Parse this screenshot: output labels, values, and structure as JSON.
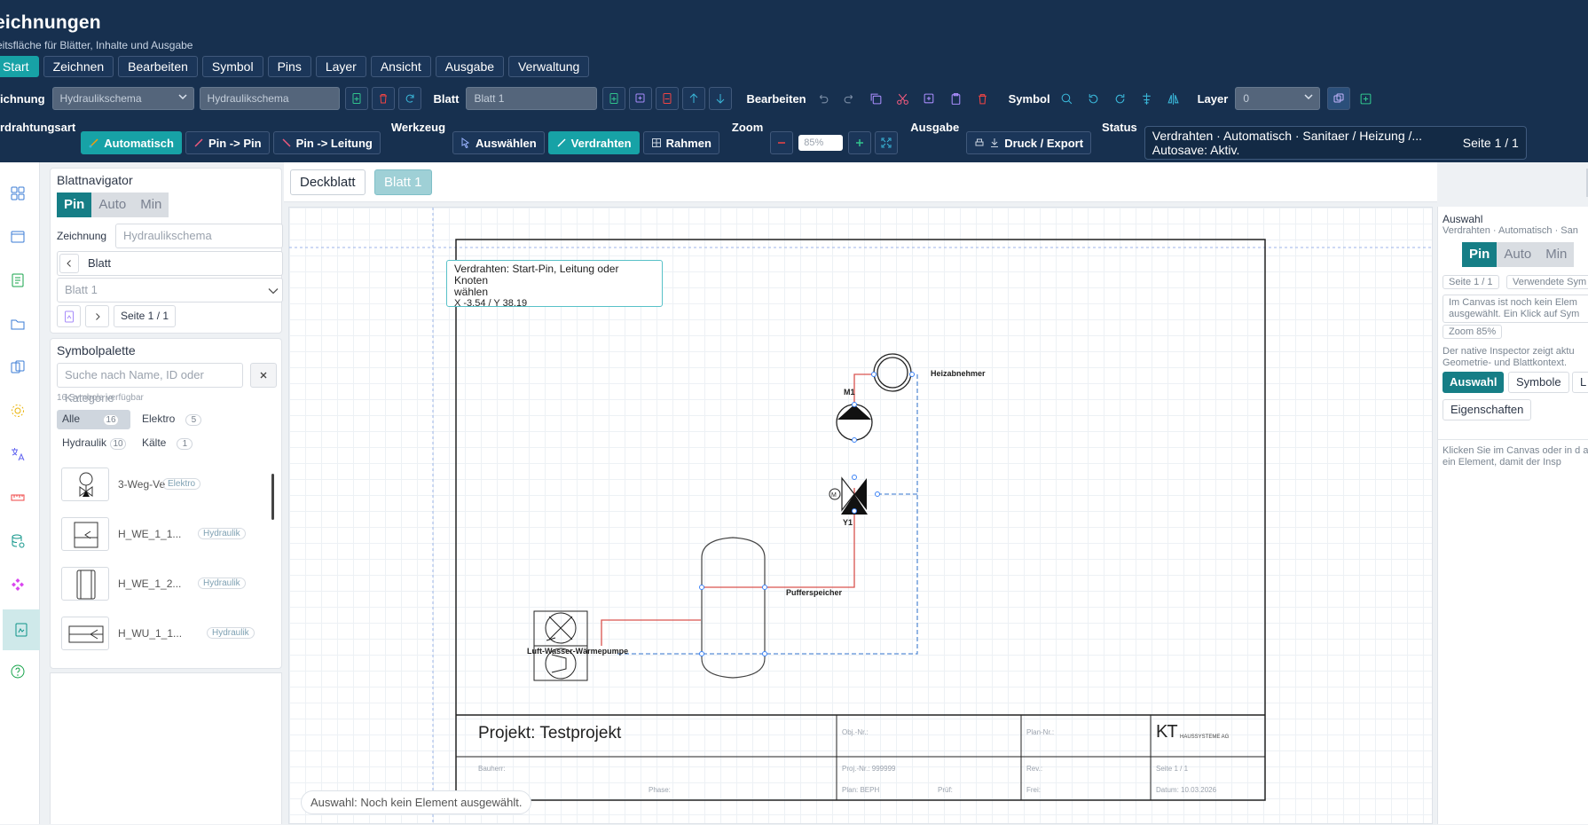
{
  "app": {
    "title": "eichnungen",
    "subtitle": "eitsfläche für Blätter, Inhalte und Ausgabe"
  },
  "menu": [
    "Start",
    "Zeichnen",
    "Bearbeiten",
    "Symbol",
    "Pins",
    "Layer",
    "Ansicht",
    "Ausgabe",
    "Verwaltung"
  ],
  "toolbar1": {
    "zeichnung_label": "ichnung",
    "zeichnung_select": "Hydraulikschema",
    "zeichnung_name": "Hydraulikschema",
    "blatt_label": "Blatt",
    "blatt_value": "Blatt 1",
    "bearbeiten_label": "Bearbeiten",
    "symbol_label": "Symbol",
    "layer_label": "Layer",
    "layer_value": "0"
  },
  "toolbar2": {
    "verdrahtung_label": "rdrahtungsart",
    "auto_btn": "Automatisch",
    "pin_pin_btn": "Pin -> Pin",
    "pin_leitung_btn": "Pin -> Leitung",
    "werkzeug_label": "Werkzeug",
    "auswaehlen_btn": "Auswählen",
    "verdrahten_btn": "Verdrahten",
    "rahmen_btn": "Rahmen",
    "zoom_label": "Zoom",
    "zoom_value": "85%",
    "ausgabe_label": "Ausgabe",
    "druck_btn": "Druck / Export",
    "status_label": "Status",
    "status_line1": "Verdrahten · Automatisch · Sanitaer / Heizung /...",
    "status_line2": "Autosave: Aktiv.",
    "page_indicator": "Seite 1 / 1"
  },
  "navigator": {
    "title": "Blattnavigator",
    "modes": [
      "Pin",
      "Auto",
      "Min"
    ],
    "zeichnung_label": "Zeichnung",
    "zeichnung_value": "Hydraulikschema",
    "blatt_label": "Blatt",
    "blatt_select": "Blatt 1",
    "seite": "Seite 1 / 1"
  },
  "palette": {
    "title": "Symbolpalette",
    "search_placeholder": "Suche nach Name, ID oder Kategorie",
    "count_text": "16 Symbole verfügbar",
    "filters": [
      {
        "label": "Alle",
        "count": "16"
      },
      {
        "label": "Elektro",
        "count": "5"
      },
      {
        "label": "Hydraulik",
        "count": "10"
      },
      {
        "label": "Kälte",
        "count": "1"
      }
    ],
    "items": [
      {
        "name": "3-Weg-Ve",
        "tag": "Elektro"
      },
      {
        "name": "H_WE_1_1...",
        "tag": "Hydraulik"
      },
      {
        "name": "H_WE_1_2...",
        "tag": "Hydraulik"
      },
      {
        "name": "H_WU_1_1...",
        "tag": "Hydraulik"
      }
    ]
  },
  "tabs": [
    "Deckblatt",
    "Blatt 1"
  ],
  "canvas": {
    "tooltip_line1": "Verdrahten: Start-Pin, Leitung oder Knoten",
    "tooltip_line2": "wählen",
    "tooltip_coords": "X -3.54 / Y 38.19",
    "labels": {
      "heizabnehmer": "Heizabnehmer",
      "m1": "M1",
      "y1": "Y1",
      "pufferspeicher": "Pufferspeicher",
      "waermepumpe": "Luft-Wasser-Wärmepumpe"
    },
    "titleblock": {
      "projekt": "Projekt: Testprojekt",
      "obj_nr": "Obj.-Nr.:",
      "plan_nr": "Plan-Nr.:",
      "logo": "KT",
      "logo_sub": "HAUSSYSTEME AG",
      "bauherr": "Bauherr:",
      "proj_nr": "Proj.-Nr.: 999999",
      "rev": "Rev.:",
      "seite": "Seite 1 / 1",
      "phase": "Phase:",
      "plan": "Plan: BEPH",
      "pruef": "Prüf:",
      "frei": "Frei:",
      "datum": "Datum: 10.03.2026"
    },
    "selection_status": "Auswahl: Noch kein Element ausgewählt."
  },
  "inspector": {
    "title": "Auswahl",
    "subtitle": "Verdrahten · Automatisch · San",
    "modes": [
      "Pin",
      "Auto",
      "Min"
    ],
    "chip_seite": "Seite 1 / 1",
    "chip_sym": "Verwendete Sym",
    "info": "Im Canvas ist noch kein Elem ausgewählt. Ein Klick auf Sym",
    "zoom": "Zoom 85%",
    "native": "Der native Inspector zeigt aktu Geometrie- und Blattkontext.",
    "tabs": [
      "Auswahl",
      "Symbole",
      "L"
    ],
    "eigenschaften": "Eigenschaften",
    "hint": "Klicken Sie im Canvas oder in d auf ein Element, damit der Insp"
  },
  "colors": {
    "header_bg": "#17304f",
    "accent": "#17a2a6",
    "wire_red": "#d9534f",
    "wire_blue": "#5b8fd6"
  }
}
